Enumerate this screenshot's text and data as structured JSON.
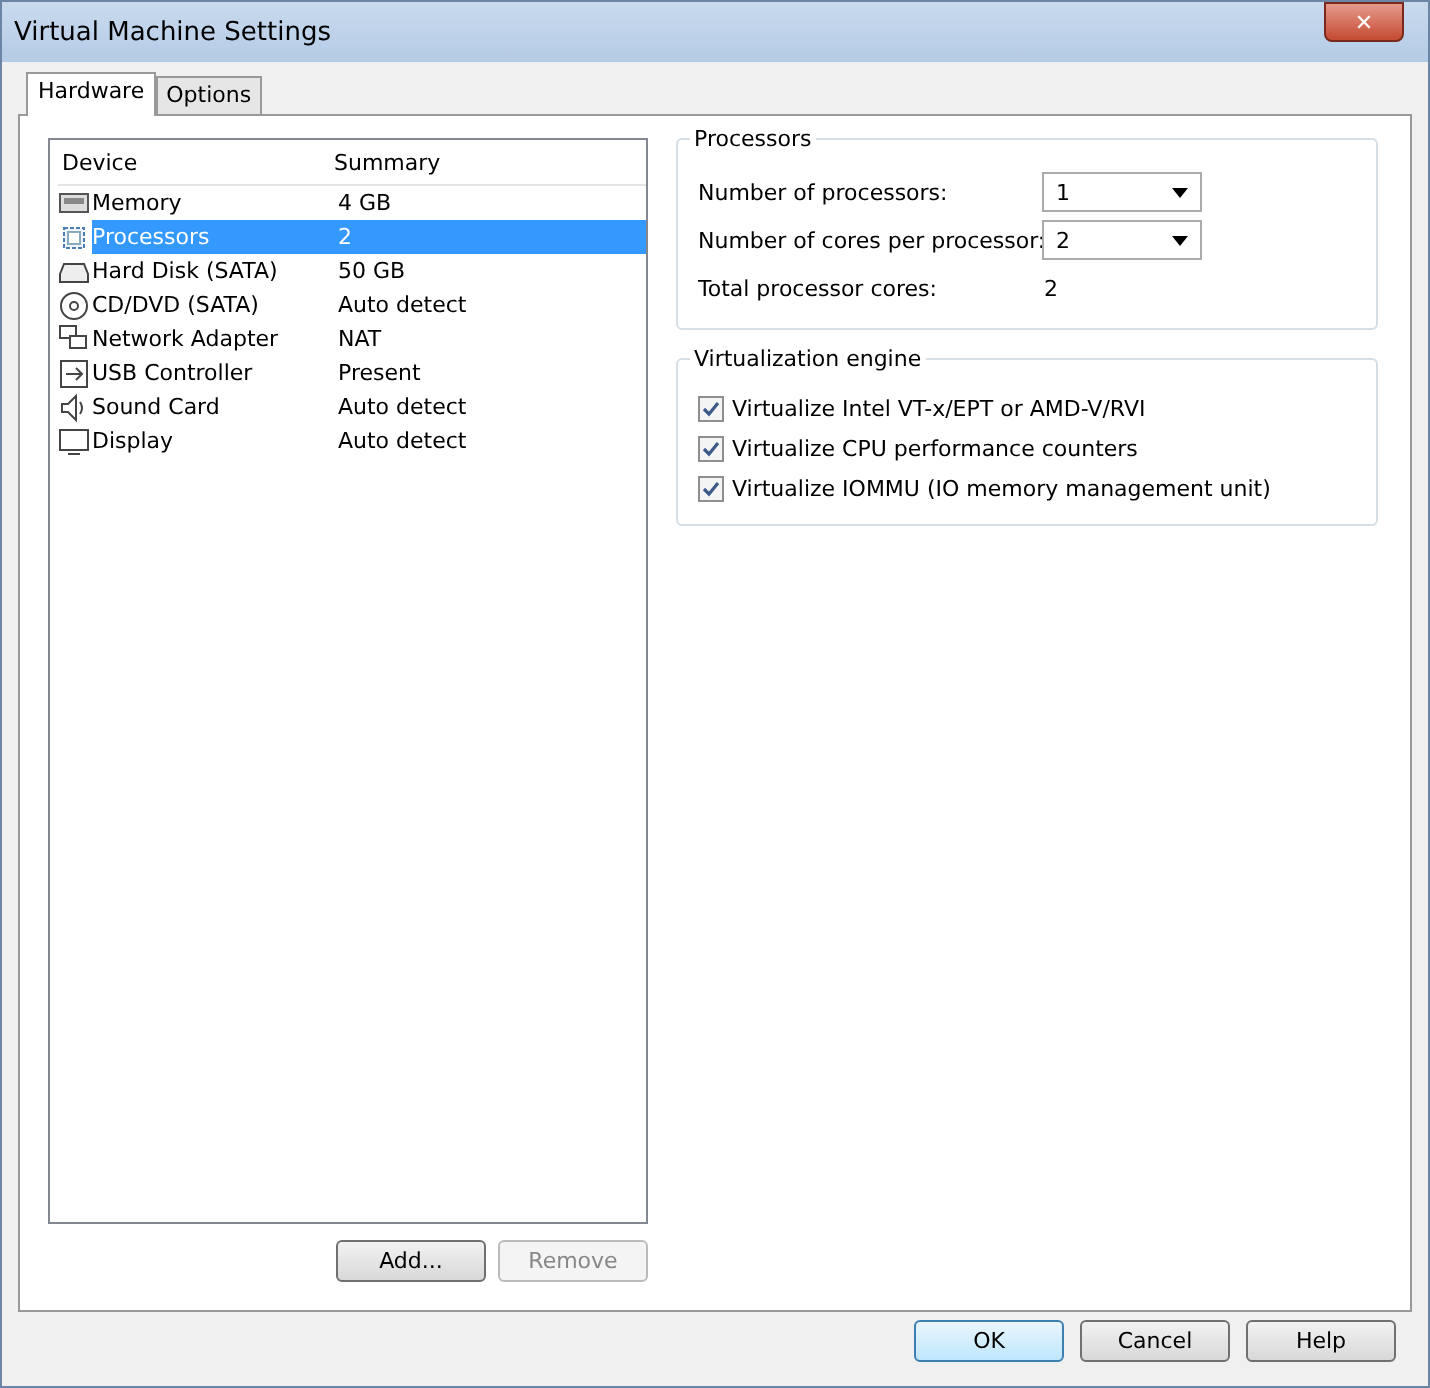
{
  "window": {
    "title": "Virtual Machine Settings",
    "close": "✕"
  },
  "tabs": [
    {
      "label": "Hardware",
      "selected": true
    },
    {
      "label": "Options",
      "selected": false
    }
  ],
  "device_list": {
    "columns": [
      "Device",
      "Summary"
    ],
    "rows": [
      {
        "device": "Memory",
        "summary": "4 GB",
        "selected": false
      },
      {
        "device": "Processors",
        "summary": "2",
        "selected": true
      },
      {
        "device": "Hard Disk (SATA)",
        "summary": "50 GB",
        "selected": false
      },
      {
        "device": "CD/DVD (SATA)",
        "summary": "Auto detect",
        "selected": false
      },
      {
        "device": "Network Adapter",
        "summary": "NAT",
        "selected": false
      },
      {
        "device": "USB Controller",
        "summary": "Present",
        "selected": false
      },
      {
        "device": "Sound Card",
        "summary": "Auto detect",
        "selected": false
      },
      {
        "device": "Display",
        "summary": "Auto detect",
        "selected": false
      }
    ]
  },
  "list_buttons": [
    {
      "label": "Add...",
      "disabled": false
    },
    {
      "label": "Remove",
      "disabled": true
    }
  ],
  "processors": {
    "title": "Processors",
    "fields": [
      {
        "kind": "dropdown",
        "label": "Number of processors:",
        "value": "1"
      },
      {
        "kind": "dropdown",
        "label": "Number of cores per processor:",
        "value": "2"
      },
      {
        "kind": "readout",
        "label": "Total processor cores:",
        "value": "2"
      }
    ]
  },
  "virtualization": {
    "title": "Virtualization engine",
    "options": [
      {
        "label": "Virtualize Intel VT-x/EPT or AMD-V/RVI",
        "checked": true
      },
      {
        "label": "Virtualize CPU performance counters",
        "checked": true
      },
      {
        "label": "Virtualize IOMMU (IO memory management unit)",
        "checked": true
      }
    ]
  },
  "buttons": [
    {
      "label": "OK",
      "default": true
    },
    {
      "label": "Cancel",
      "default": false
    },
    {
      "label": "Help",
      "default": false
    }
  ]
}
